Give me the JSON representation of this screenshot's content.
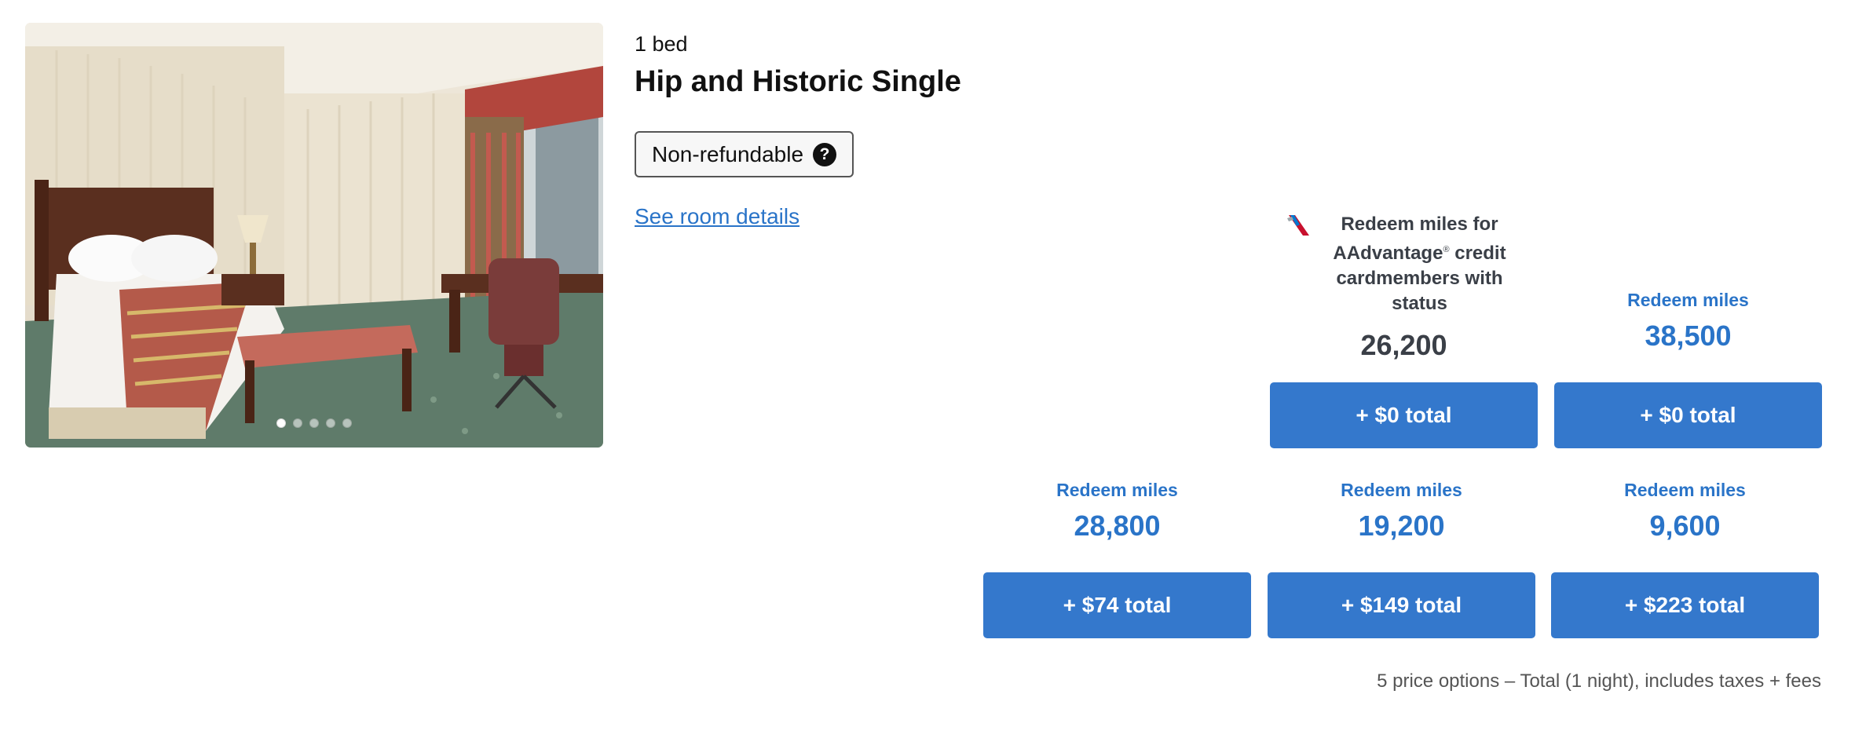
{
  "room": {
    "bed_count": "1 bed",
    "title": "Hip and Historic Single",
    "refund_badge": "Non-refundable",
    "help_icon": "question-circle-icon",
    "details_link": "See room details",
    "photo_dots": 5,
    "photo_active_index": 0
  },
  "status_option": {
    "icon": "american-airlines-logo-icon",
    "label_line1": "Redeem miles for",
    "label_brand": "AAdvantage",
    "label_reg": "®",
    "label_rest": " credit cardmembers with status",
    "miles": "26,200",
    "button": "+ $0 total"
  },
  "options_row1": [
    {
      "label": "Redeem miles",
      "miles": "38,500",
      "button": "+ $0 total"
    }
  ],
  "options_row2": [
    {
      "label": "Redeem miles",
      "miles": "28,800",
      "button": "+ $74 total"
    },
    {
      "label": "Redeem miles",
      "miles": "19,200",
      "button": "+ $149 total"
    },
    {
      "label": "Redeem miles",
      "miles": "9,600",
      "button": "+ $223 total"
    }
  ],
  "footnote": "5 price options – Total (1 night), includes taxes + fees",
  "colors": {
    "accent_blue": "#2a74c8",
    "button_blue": "#3478cc",
    "status_text": "#3a3f47"
  }
}
